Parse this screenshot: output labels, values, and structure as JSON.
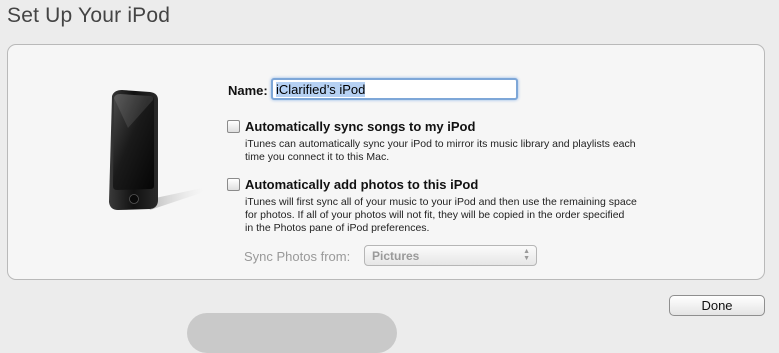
{
  "page": {
    "title": "Set Up Your iPod"
  },
  "name_field": {
    "label": "Name:",
    "value": "iClarified’s iPod"
  },
  "options": {
    "sync_songs": {
      "label": "Automatically sync songs to my iPod",
      "checked": false,
      "description_lines": [
        "iTunes can automatically sync your iPod to mirror its music library and playlists each",
        "time you connect it to this Mac."
      ]
    },
    "add_photos": {
      "label": "Automatically add photos to this iPod",
      "checked": false,
      "description_lines": [
        "iTunes will first sync all of your music to your iPod and then use the remaining space",
        "for photos. If all of your photos will not fit, they will be copied in the order specified",
        "in the Photos pane of iPod preferences."
      ]
    }
  },
  "sync_photos": {
    "label": "Sync Photos from:",
    "selected": "Pictures",
    "enabled": false
  },
  "footer": {
    "done_label": "Done"
  },
  "colors": {
    "background": "#ececec",
    "panel": "#f6f6f6",
    "focus_ring": "#7ea7d8",
    "selection": "#b6d1f3",
    "disabled_text": "#999999"
  }
}
